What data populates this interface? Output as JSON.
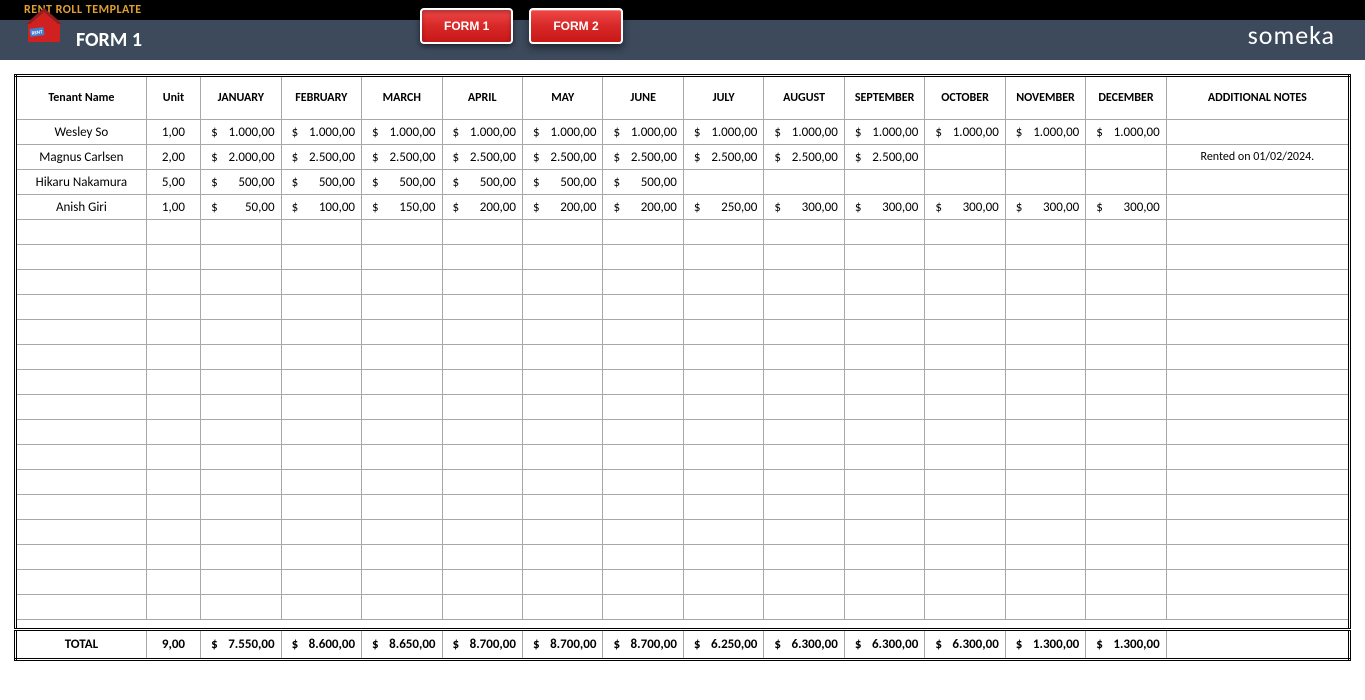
{
  "topbar": {
    "title": "RENT ROLL TEMPLATE"
  },
  "header": {
    "form_title": "FORM 1",
    "buttons": [
      {
        "label": "FORM 1",
        "active": true
      },
      {
        "label": "FORM 2",
        "active": false
      }
    ],
    "brand": "someka"
  },
  "table": {
    "headers": [
      "Tenant Name",
      "Unit",
      "JANUARY",
      "FEBRUARY",
      "MARCH",
      "APRIL",
      "MAY",
      "JUNE",
      "JULY",
      "AUGUST",
      "SEPTEMBER",
      "OCTOBER",
      "NOVEMBER",
      "DECEMBER",
      "ADDITIONAL NOTES"
    ],
    "rows": [
      {
        "name": "Wesley So",
        "unit": "1,00",
        "months": [
          "1.000,00",
          "1.000,00",
          "1.000,00",
          "1.000,00",
          "1.000,00",
          "1.000,00",
          "1.000,00",
          "1.000,00",
          "1.000,00",
          "1.000,00",
          "1.000,00",
          "1.000,00"
        ],
        "notes": ""
      },
      {
        "name": "Magnus Carlsen",
        "unit": "2,00",
        "months": [
          "2.000,00",
          "2.500,00",
          "2.500,00",
          "2.500,00",
          "2.500,00",
          "2.500,00",
          "2.500,00",
          "2.500,00",
          "2.500,00",
          "",
          "",
          ""
        ],
        "notes": "Rented on 01/02/2024."
      },
      {
        "name": "Hikaru Nakamura",
        "unit": "5,00",
        "months": [
          "500,00",
          "500,00",
          "500,00",
          "500,00",
          "500,00",
          "500,00",
          "",
          "",
          "",
          "",
          "",
          ""
        ],
        "notes": ""
      },
      {
        "name": "Anish Giri",
        "unit": "1,00",
        "months": [
          "50,00",
          "100,00",
          "150,00",
          "200,00",
          "200,00",
          "200,00",
          "250,00",
          "300,00",
          "300,00",
          "300,00",
          "300,00",
          "300,00"
        ],
        "notes": ""
      }
    ],
    "empty_rows": 16,
    "total": {
      "label": "TOTAL",
      "unit": "9,00",
      "months": [
        "7.550,00",
        "8.600,00",
        "8.650,00",
        "8.700,00",
        "8.700,00",
        "8.700,00",
        "6.250,00",
        "6.300,00",
        "6.300,00",
        "6.300,00",
        "1.300,00",
        "1.300,00"
      ],
      "notes": ""
    },
    "currency": "$"
  }
}
